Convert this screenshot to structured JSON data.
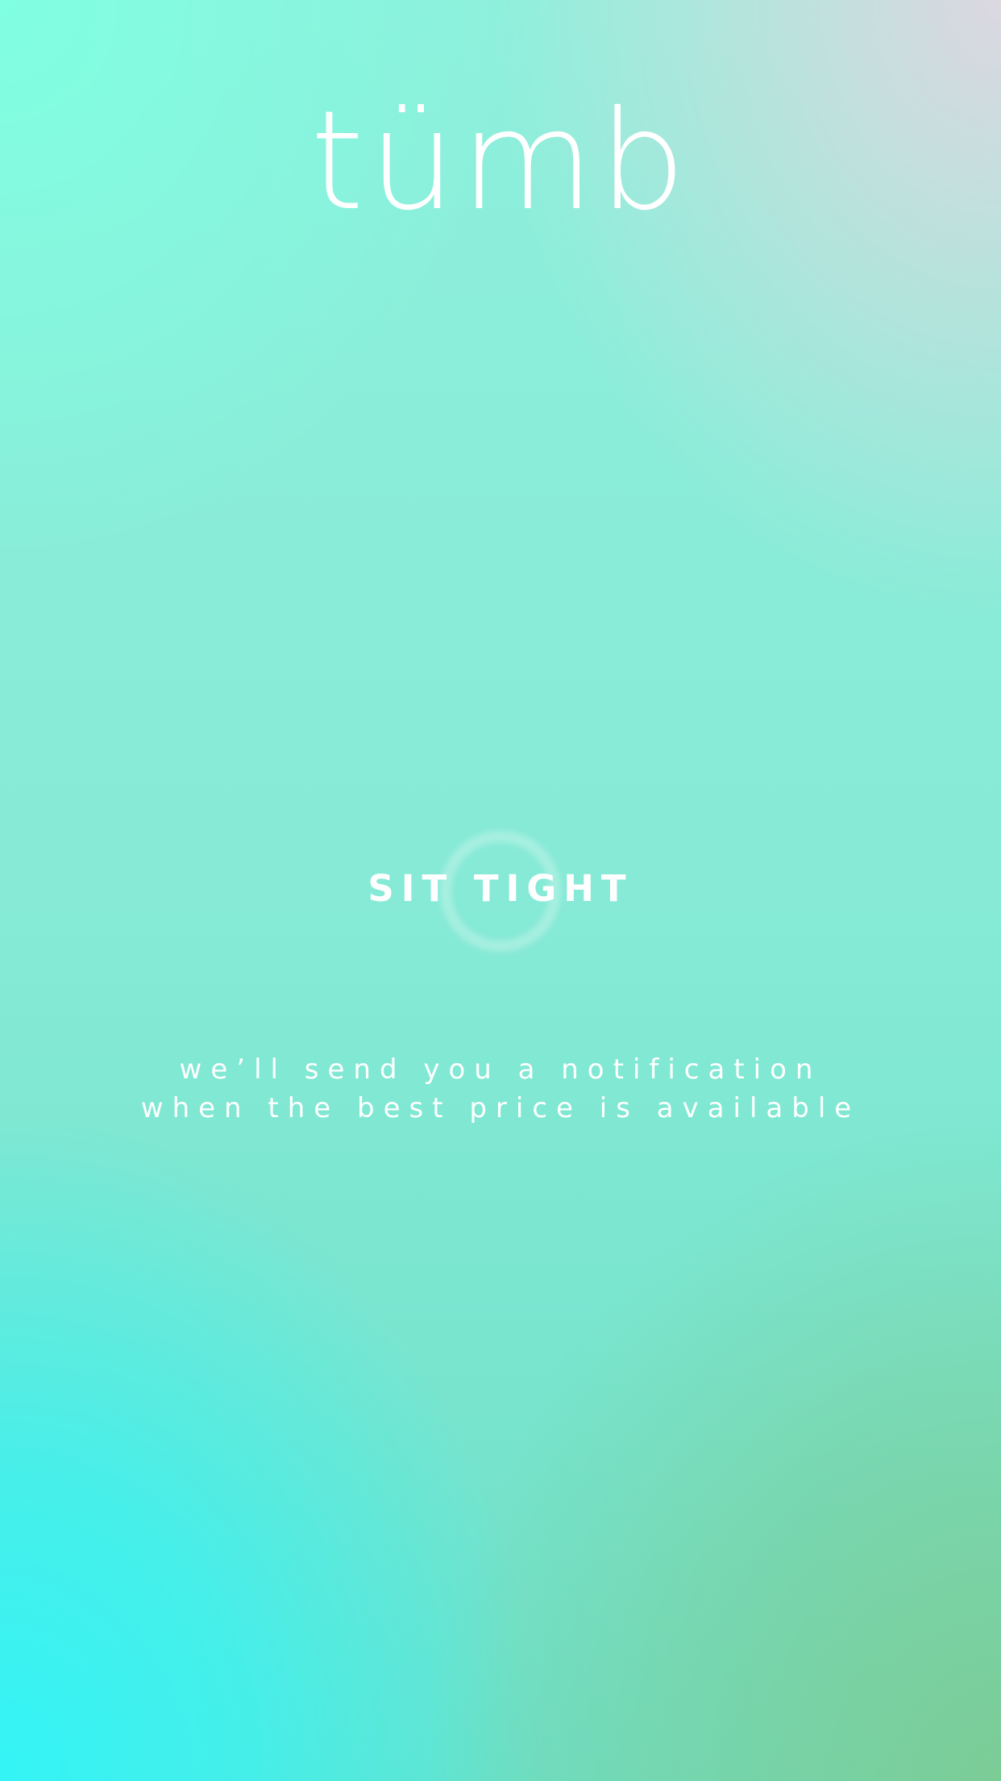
{
  "app": {
    "logo_text": "tümb"
  },
  "loading": {
    "indicator_icon": "spinner-ring-icon",
    "title": "SIT TIGHT",
    "message_line1": "we’ll send you a notification",
    "message_line2": "when the best price is available"
  },
  "colors": {
    "top_left": "#80FFE2",
    "top_right": "#E0D6E0",
    "bottom_left": "#34F4F6",
    "bottom_right": "#7CCC96",
    "text": "#FFFFFF"
  }
}
